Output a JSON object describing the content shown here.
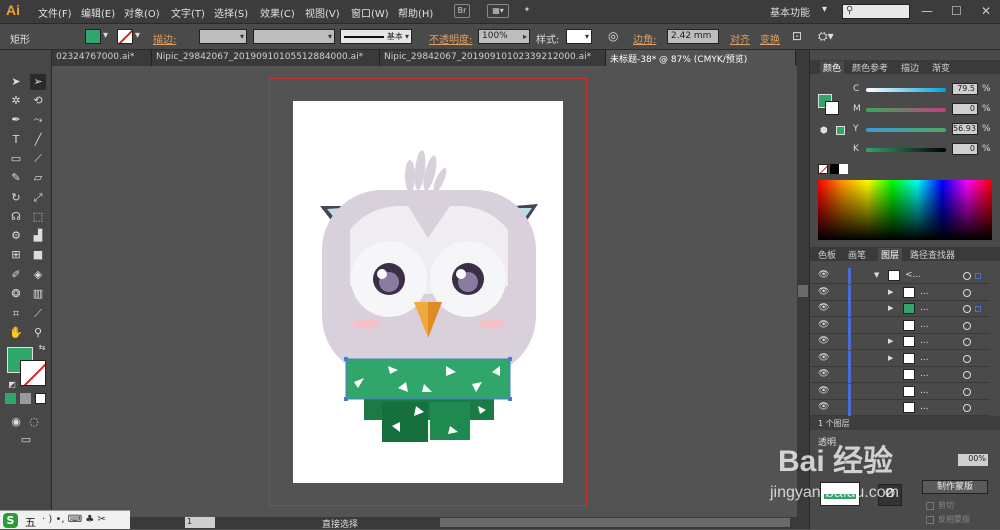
{
  "app": {
    "logo": "Ai",
    "menus": [
      "文件(F)",
      "编辑(E)",
      "对象(O)",
      "文字(T)",
      "选择(S)",
      "效果(C)",
      "视图(V)",
      "窗口(W)",
      "帮助(H)"
    ],
    "workspace": "基本功能",
    "bridge_label": "Br"
  },
  "control": {
    "object_label": "矩形",
    "stroke_link": "描边:",
    "stroke_profile": "基本",
    "opacity_link": "不透明度:",
    "opacity_value": "100%",
    "style_label": "样式:",
    "corner_link": "边角:",
    "corner_value": "2.42 mm",
    "align_link": "对齐",
    "transform_link": "变换",
    "fill_color": "#30a66a"
  },
  "tabs": [
    {
      "label": "02324767000.ai*"
    },
    {
      "label": "Nipic_29842067_20190910105512884000.ai*"
    },
    {
      "label": "Nipic_29842067_20190910102339212000.ai*"
    },
    {
      "label": "未标题-38* @ 87% (CMYK/预览)"
    }
  ],
  "color_panel": {
    "tabs": [
      "颜色",
      "颜色参考",
      "描边",
      "渐变"
    ],
    "c_label": "C",
    "c_value": "79.5",
    "m_label": "M",
    "m_value": "0",
    "y_label": "Y",
    "y_value": "56.93",
    "k_label": "K",
    "k_value": "0",
    "pct": "%"
  },
  "layers_panel": {
    "tabs": [
      "色板",
      "画笔",
      "图层",
      "路径查找器"
    ],
    "row_dots": "...",
    "top_row": "<...",
    "footer": "1 个图层"
  },
  "bottom_panel": {
    "transparency_label": "透明",
    "opacity_value": "00%",
    "make_mask": "制作蒙版",
    "clip": "剪切",
    "invert_mask": "反相蒙版"
  },
  "status": {
    "zoom": "87%",
    "page": "1",
    "tool_name": "直接选择"
  },
  "watermark": {
    "main": "Bai 经验",
    "url": "jingyan.baidu.com"
  },
  "ime": {
    "logo": "S",
    "label": "五",
    "icons": "· ) •, ⌨ ♣ ✂"
  },
  "colors": {
    "owl_body": "#d8d0da",
    "owl_face": "#f3f1f3",
    "scarf": "#30a66a",
    "scarf_dark": "#1b7a46",
    "beak": "#f2a93b",
    "cheek": "#f4c2c6"
  }
}
